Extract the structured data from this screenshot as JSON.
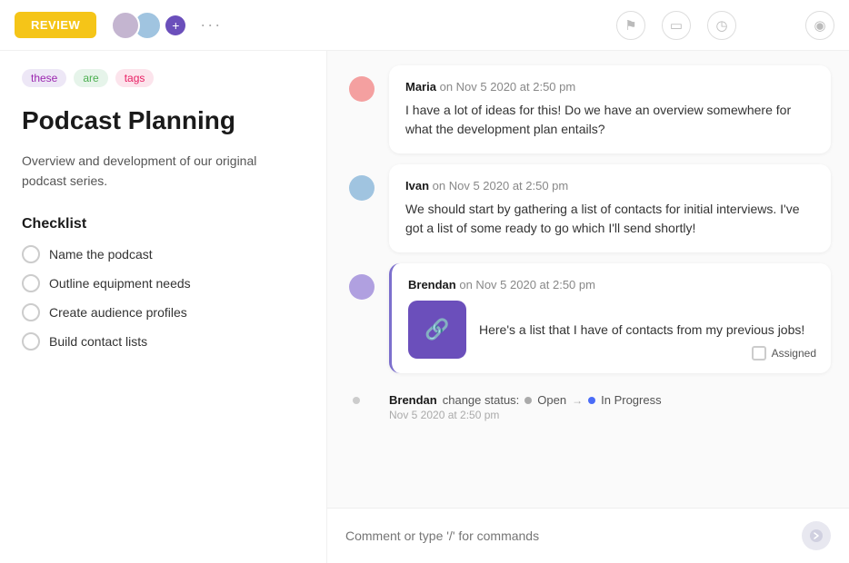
{
  "topbar": {
    "review_label": "REVIEW",
    "three_dots": "···",
    "toolbar_icons": [
      {
        "name": "flag-icon",
        "symbol": "⚑"
      },
      {
        "name": "calendar-icon",
        "symbol": "▭"
      },
      {
        "name": "clock-icon",
        "symbol": "◷"
      }
    ],
    "eye_icon": "◉"
  },
  "tags": [
    {
      "id": "tag-these",
      "label": "these",
      "style": "purple"
    },
    {
      "id": "tag-are",
      "label": "are",
      "style": "green"
    },
    {
      "id": "tag-tags",
      "label": "tags",
      "style": "pink"
    }
  ],
  "page": {
    "title": "Podcast Planning",
    "description": "Overview and development of our original podcast series."
  },
  "checklist": {
    "title": "Checklist",
    "items": [
      {
        "id": "check-1",
        "label": "Name the podcast"
      },
      {
        "id": "check-2",
        "label": "Outline equipment needs"
      },
      {
        "id": "check-3",
        "label": "Create audience profiles"
      },
      {
        "id": "check-4",
        "label": "Build contact lists"
      }
    ]
  },
  "comments": [
    {
      "id": "comment-maria",
      "author": "Maria",
      "timestamp": "on Nov 5 2020 at 2:50 pm",
      "text": "I have a lot of ideas for this! Do we have an overview somewhere for what the development plan entails?",
      "avatar_color": "#f4a0a0",
      "highlighted": false
    },
    {
      "id": "comment-ivan",
      "author": "Ivan",
      "timestamp": "on Nov 5 2020 at 2:50 pm",
      "text": "We should start by gathering a list of contacts for initial interviews. I've got a list of some ready to go which I'll send shortly!",
      "avatar_color": "#a0c4e0",
      "highlighted": false
    },
    {
      "id": "comment-brendan",
      "author": "Brendan",
      "timestamp": "on Nov 5 2020 at 2:50 pm",
      "text": "Here's a list that I have of contacts from my previous jobs!",
      "avatar_color": "#b0a0e0",
      "highlighted": true,
      "has_attachment": true,
      "attachment_icon": "🔗",
      "assigned_label": "Assigned"
    }
  ],
  "status_change": {
    "author": "Brendan",
    "label": "change status:",
    "from": "Open",
    "to": "In Progress",
    "timestamp": "Nov 5 2020 at 2:50 pm"
  },
  "comment_input": {
    "placeholder": "Comment or type '/' for commands"
  }
}
